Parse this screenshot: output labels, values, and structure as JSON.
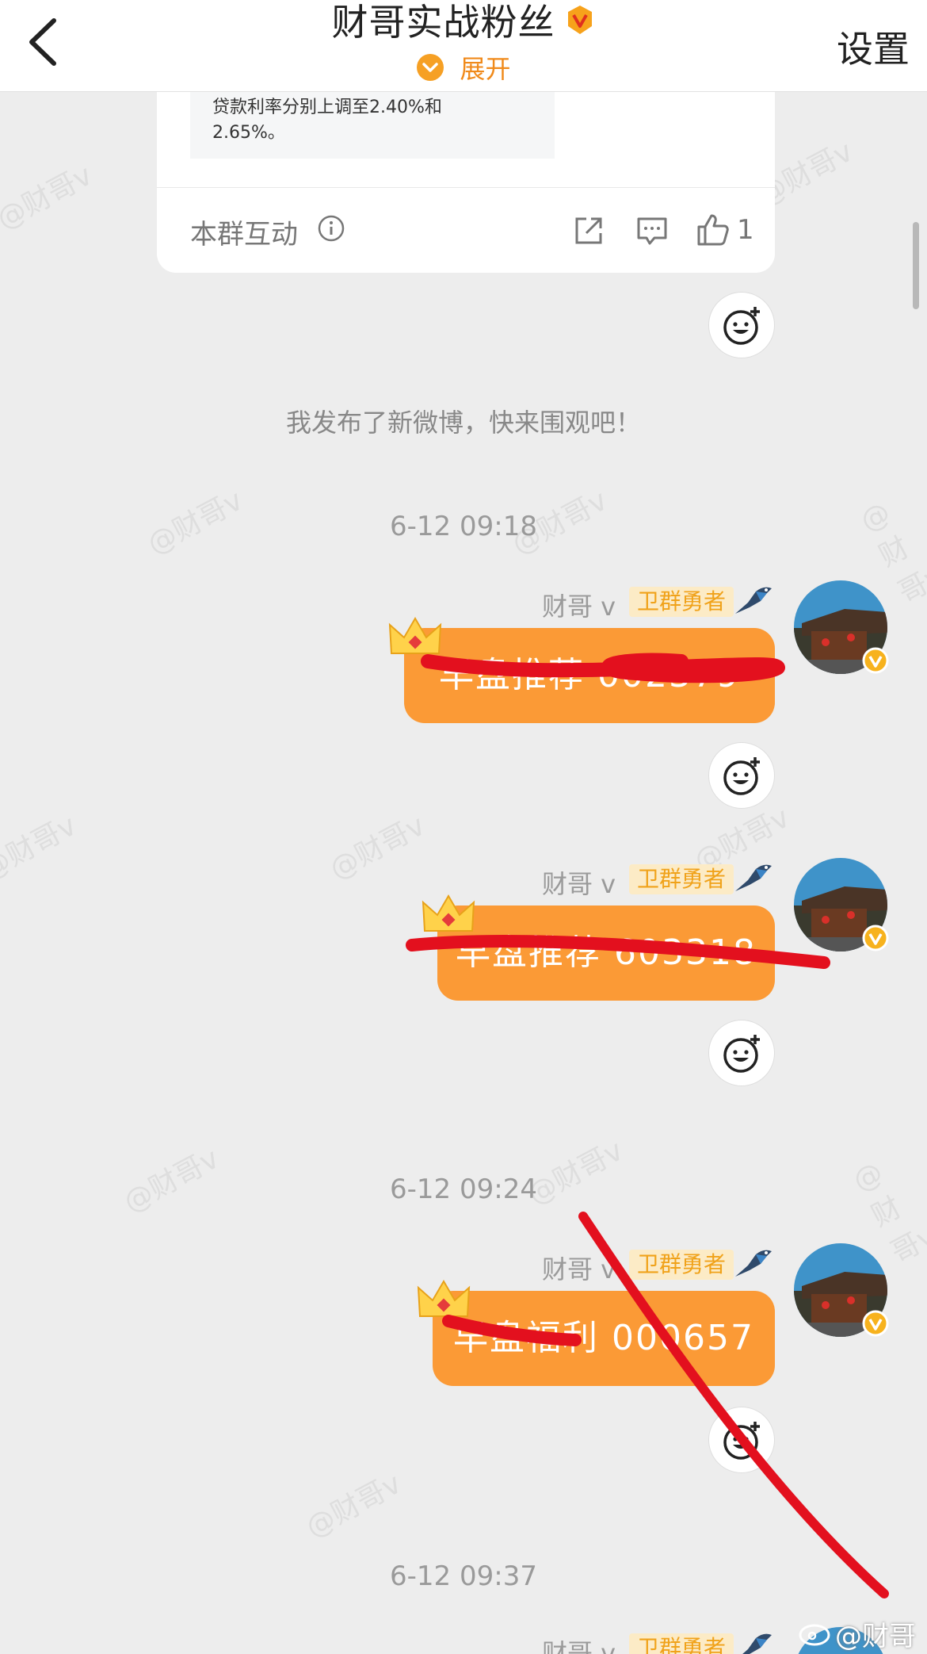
{
  "header": {
    "title": "财哥实战粉丝",
    "expand_label": "展开",
    "settings_label": "设置"
  },
  "shared_card": {
    "quote_lines": [
      "贷款利率分别上调至2.40%和",
      "2.65%。"
    ],
    "footer_label": "本群互动",
    "like_count": "1"
  },
  "system_message": "我发布了新微博，快来围观吧！",
  "messages": [
    {
      "timestamp": "6-12 09:18",
      "sender": "财哥 v",
      "tag": "卫群勇者",
      "text": "早盘推荐 002379"
    },
    {
      "timestamp": "",
      "sender": "财哥 v",
      "tag": "卫群勇者",
      "text": "早盘推荐 603318"
    },
    {
      "timestamp": "6-12 09:24",
      "sender": "财哥 v",
      "tag": "卫群勇者",
      "text": "早盘福利 000657"
    },
    {
      "timestamp": "6-12 09:37",
      "sender": "财哥 v",
      "tag": "卫群勇者",
      "text": ""
    }
  ],
  "watermarks": [
    "@财哥v",
    "@财哥v",
    "@财哥v",
    "@财哥v",
    "@财哥v",
    "@财哥v",
    "@财哥v",
    "@财哥v",
    "@财哥v",
    "@财哥v",
    "@财哥v",
    "@财哥v"
  ],
  "corner_watermark": "@财哥v",
  "colors": {
    "bubble": "#fb9a36",
    "accent": "#f08a1b",
    "tag_bg": "#fcebc6",
    "tag_text": "#f0a21a",
    "scribble": "#e3101e"
  },
  "icons": [
    "back-arrow-icon",
    "vip-badge-icon",
    "chevron-down-icon",
    "info-icon",
    "share-icon",
    "comment-icon",
    "like-icon",
    "add-emoji-icon",
    "crown-icon",
    "bird-icon",
    "verified-badge-icon"
  ]
}
